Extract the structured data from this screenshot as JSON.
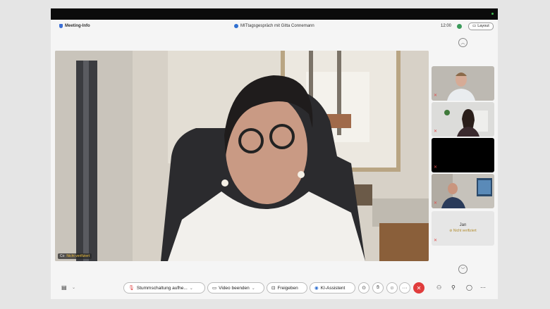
{
  "titlebar": {
    "meeting_info": "Meeting-Info",
    "title": "MITtagsgespräch mit Gitta Connemann",
    "clock": "12:00",
    "layout_label": "Layout"
  },
  "main_video": {
    "name": "Co",
    "not_verified": "Nicht verifiziert"
  },
  "tiles": {
    "jan": {
      "name": "Jan",
      "status": "Nicht verifiziert"
    }
  },
  "toolbar": {
    "mute_label": "Stummschaltung aufhe...",
    "video_label": "Video beenden",
    "share_label": "Freigeben",
    "ai_label": "KI-Assistent"
  },
  "colors": {
    "hangup": "#e03c3c",
    "muted_icon": "#e04b4b",
    "verified_warning": "#b08a2a",
    "accent": "#2f6fd0"
  },
  "icons": [
    "shield-icon",
    "chat-icon",
    "mic-off-icon",
    "video-icon",
    "share-icon",
    "ai-icon",
    "record-icon",
    "hand-icon",
    "emoji-icon",
    "more-icon",
    "hangup-icon",
    "participants-icon",
    "add-person-icon",
    "chat-bubble-icon",
    "ellipsis-icon"
  ]
}
